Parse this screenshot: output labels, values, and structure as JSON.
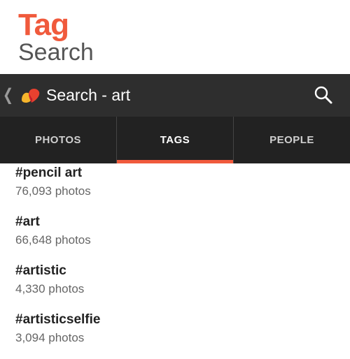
{
  "promo": {
    "title": "Tag",
    "subtitle": "Search"
  },
  "actionbar": {
    "title": "Search - art",
    "back_icon": "chevron-left-icon",
    "logo_icon": "app-logo-icon",
    "search_icon": "search-icon"
  },
  "tabs": [
    {
      "label": "PHOTOS",
      "active": false
    },
    {
      "label": "TAGS",
      "active": true
    },
    {
      "label": "PEOPLE",
      "active": false
    }
  ],
  "results": [
    {
      "tag": "#pencil art",
      "count": "76,093 photos"
    },
    {
      "tag": "#art",
      "count": "66,648 photos"
    },
    {
      "tag": "#artistic",
      "count": "4,330 photos"
    },
    {
      "tag": "#artisticselfie",
      "count": "3,094 photos"
    }
  ],
  "colors": {
    "accent": "#f05a3c",
    "actionbar": "#2e2e2e",
    "tabbar": "#222222",
    "logo_yellow": "#f7b52c",
    "logo_red": "#e8412f"
  }
}
